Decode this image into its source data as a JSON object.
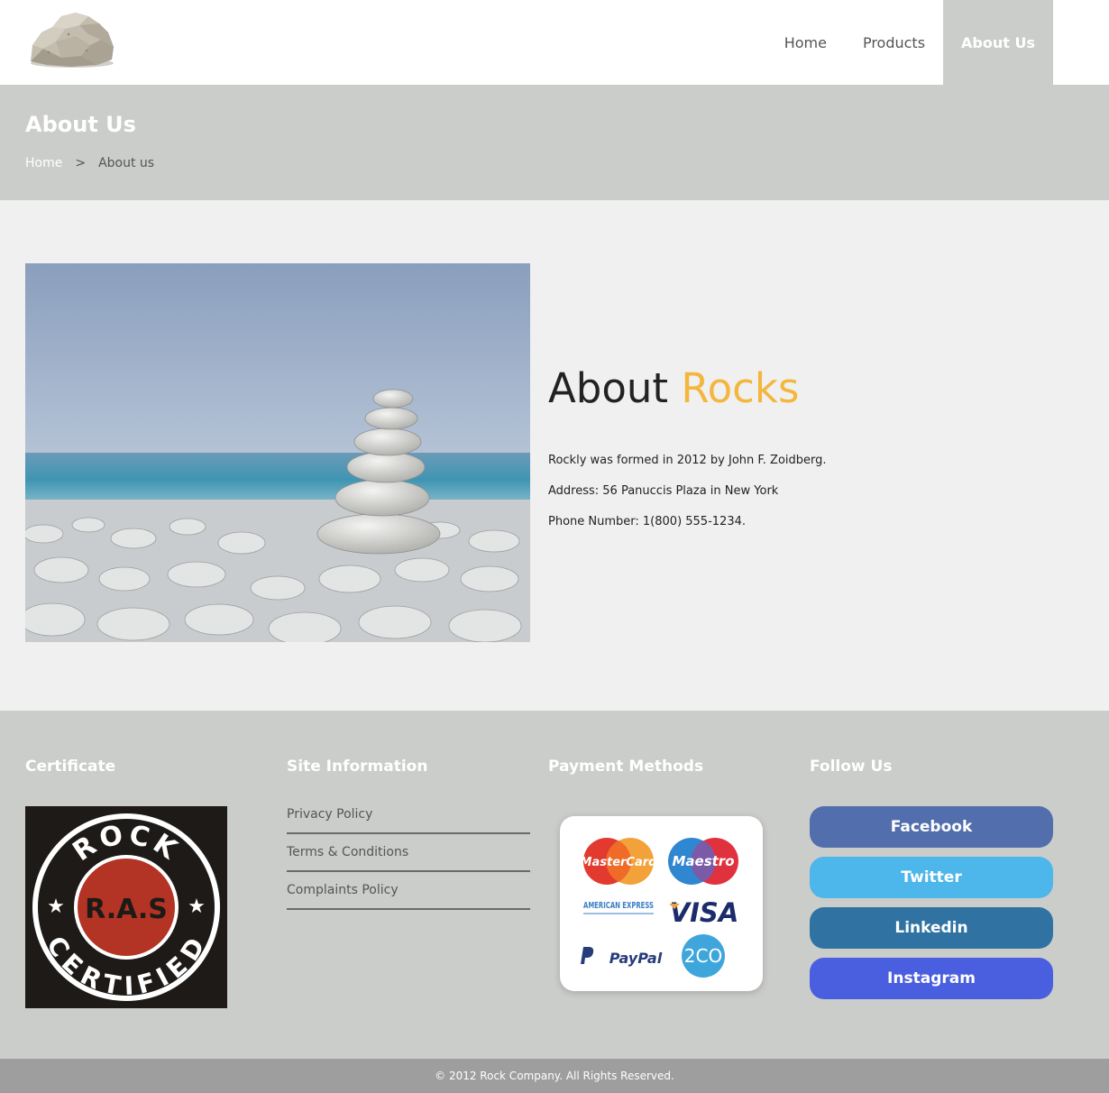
{
  "header": {
    "logo_icon": "rock-logo",
    "nav": [
      {
        "label": "Home"
      },
      {
        "label": "Products"
      },
      {
        "label": "About Us",
        "active": true
      }
    ]
  },
  "banner": {
    "title": "About Us",
    "breadcrumb": {
      "home": "Home",
      "separator": ">",
      "current": "About us"
    }
  },
  "about": {
    "title_plain": "About",
    "title_accent": "Rocks",
    "lines": [
      "Rockly was formed in 2012 by John F. Zoidberg.",
      "Address: 56 Panuccis Plaza in New York",
      "Phone Number: 1(800) 555-1234."
    ]
  },
  "footer": {
    "certificate": {
      "heading": "Certificate",
      "badge_top": "ROCK",
      "badge_center": "R.A.S",
      "badge_bottom": "CERTIFIED"
    },
    "site_info": {
      "heading": "Site Information",
      "links": [
        "Privacy Policy",
        "Terms & Conditions",
        "Complaints Policy"
      ]
    },
    "payment": {
      "heading": "Payment Methods",
      "methods": [
        "MasterCard",
        "Maestro",
        "AMERICAN EXPRESS",
        "VISA",
        "PayPal",
        "2CO"
      ]
    },
    "follow": {
      "heading": "Follow Us",
      "buttons": [
        {
          "label": "Facebook",
          "color": "#536ead"
        },
        {
          "label": "Twitter",
          "color": "#4db6ea"
        },
        {
          "label": "Linkedin",
          "color": "#3073a3"
        },
        {
          "label": "Instagram",
          "color": "#4a5ee0"
        }
      ]
    }
  },
  "copyright": "© 2012 Rock Company. All Rights Reserved.",
  "colors": {
    "accent": "#f4b63d",
    "banner_bg": "#cbcdca",
    "page_bg": "#f0f0f0",
    "copyright_bg": "#9e9e9e"
  }
}
